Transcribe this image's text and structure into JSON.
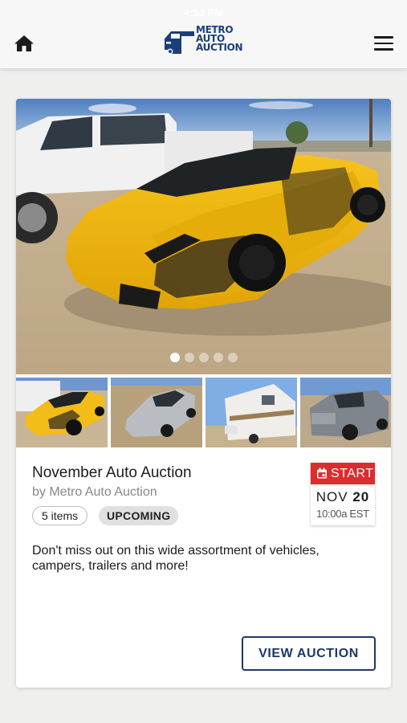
{
  "status_bar": {
    "time": "4:53 PM"
  },
  "header": {
    "home_icon": "home-icon",
    "menu_icon": "hamburger-menu-icon",
    "logo": {
      "line1": "METRO",
      "line2": "AUTO",
      "line3": "AUCTION",
      "color": "#1b3f78"
    }
  },
  "auction": {
    "title": "November Auto Auction",
    "byline": "by Metro Auto Auction",
    "items_count": "5 items",
    "status": "UPCOMING",
    "start": {
      "label": "START",
      "month": "NOV",
      "day": "20",
      "time": "10:00a EST",
      "color": "#dc2c2c"
    },
    "description": "Don't miss out on this wide assortment of vehicles, campers, trailers and more!",
    "button_label": "VIEW AUCTION",
    "carousel": {
      "total_slides": 5,
      "active_slide": 1
    },
    "thumbnails": [
      "yellow sports convertible",
      "silver sports car",
      "travel trailer camper",
      "gray pickup truck"
    ]
  },
  "colors": {
    "accent": "#1f3768",
    "background": "#efefed"
  }
}
